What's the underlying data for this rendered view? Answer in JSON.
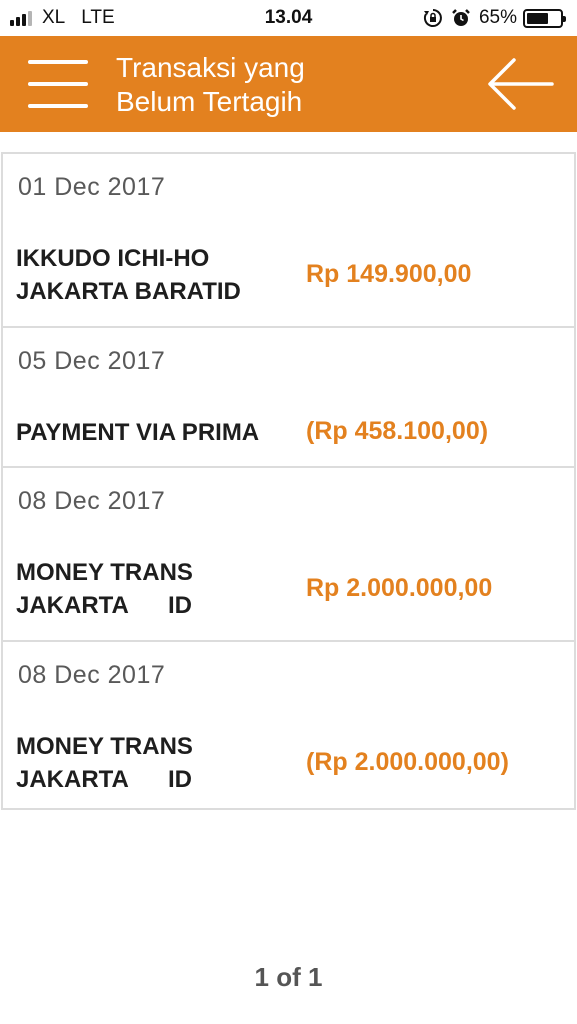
{
  "status_bar": {
    "carrier": "XL",
    "network": "LTE",
    "time": "13.04",
    "battery_percent": "65%",
    "battery_level": 0.65
  },
  "header": {
    "title_line1": "Transaksi yang",
    "title_line2": "Belum Tertagih",
    "menu_icon": "hamburger-menu-icon",
    "back_icon": "arrow-left-icon"
  },
  "transactions": [
    {
      "date": "01 Dec 2017",
      "description": "IKKUDO ICHI-HO\nJAKARTA BARATID",
      "amount": "Rp 149.900,00"
    },
    {
      "date": "05 Dec 2017",
      "description": "PAYMENT VIA PRIMA",
      "amount": "(Rp 458.100,00)"
    },
    {
      "date": "08 Dec 2017",
      "description": "MONEY TRANS\nJAKARTA      ID",
      "amount": "Rp 2.000.000,00"
    },
    {
      "date": "08 Dec 2017",
      "description": "MONEY TRANS\nJAKARTA      ID",
      "amount": "(Rp 2.000.000,00)"
    }
  ],
  "pagination": {
    "label": "1 of 1"
  },
  "colors": {
    "accent": "#e3811f",
    "divider": "#dcdcdc",
    "date_text": "#595959"
  }
}
